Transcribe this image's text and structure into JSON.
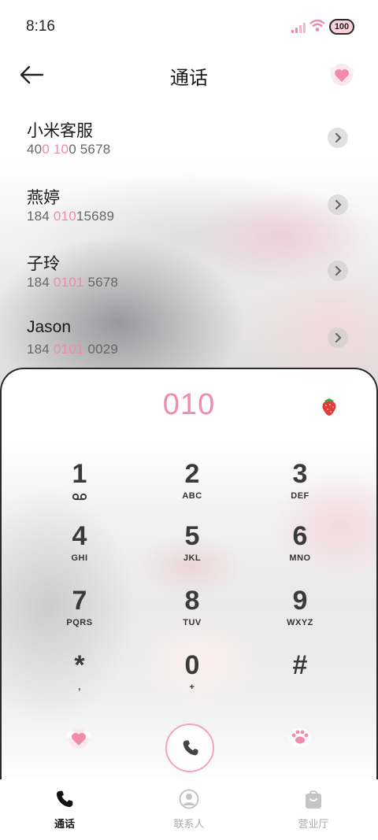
{
  "status": {
    "time": "8:16",
    "battery": "100"
  },
  "header": {
    "title": "通话"
  },
  "contacts": [
    {
      "name": "小米客服",
      "number_parts": [
        "40",
        "0 10",
        "0 5678"
      ]
    },
    {
      "name": "燕婷",
      "number_parts": [
        "184 ",
        "010",
        "15689"
      ]
    },
    {
      "name": "子玲",
      "number_parts": [
        "184 ",
        "0101",
        " 5678"
      ]
    },
    {
      "name": "Jason",
      "number_parts": [
        "184 ",
        "0101",
        " 0029"
      ]
    }
  ],
  "dialer": {
    "display": "010",
    "keys": [
      {
        "digit": "1",
        "letters": ""
      },
      {
        "digit": "2",
        "letters": "ABC"
      },
      {
        "digit": "3",
        "letters": "DEF"
      },
      {
        "digit": "4",
        "letters": "GHI"
      },
      {
        "digit": "5",
        "letters": "JKL"
      },
      {
        "digit": "6",
        "letters": "MNO"
      },
      {
        "digit": "7",
        "letters": "PQRS"
      },
      {
        "digit": "8",
        "letters": "TUV"
      },
      {
        "digit": "9",
        "letters": "WXYZ"
      },
      {
        "digit": "*",
        "letters": ","
      },
      {
        "digit": "0",
        "letters": "+"
      },
      {
        "digit": "#",
        "letters": ""
      }
    ]
  },
  "nav": [
    {
      "label": "通话",
      "icon": "phone-icon",
      "active": true
    },
    {
      "label": "联系人",
      "icon": "person-icon",
      "active": false
    },
    {
      "label": "营业厅",
      "icon": "bag-icon",
      "active": false
    }
  ],
  "colors": {
    "accent_pink": "#f28aaa",
    "text": "#1a1a1a",
    "muted": "#666666",
    "nav_inactive": "#aaaaaa"
  }
}
